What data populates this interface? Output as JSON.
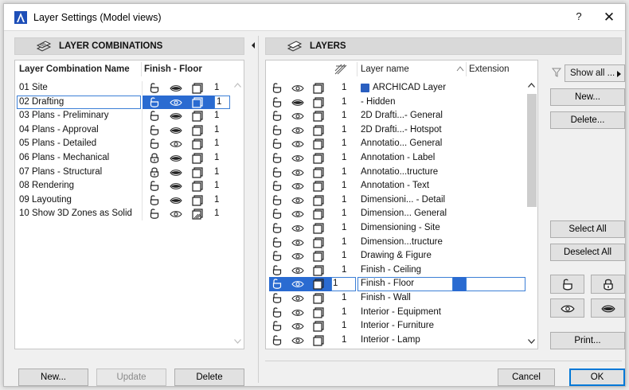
{
  "window": {
    "title": "Layer Settings (Model views)",
    "help_label": "?",
    "close_label": "✕"
  },
  "layer_combinations": {
    "header": "LAYER COMBINATIONS",
    "columns": {
      "name": "Layer Combination Name",
      "finish": "Finish - Floor"
    },
    "rows": [
      {
        "name": "01 Site",
        "lock": "unlocked",
        "visibility": "closed-eye",
        "wire": "solid",
        "pen": "1",
        "selected": false
      },
      {
        "name": "02 Drafting",
        "lock": "unlocked",
        "visibility": "open-eye",
        "wire": "solid",
        "pen": "1",
        "selected": true
      },
      {
        "name": "03 Plans - Preliminary",
        "lock": "unlocked",
        "visibility": "closed-eye",
        "wire": "solid",
        "pen": "1",
        "selected": false
      },
      {
        "name": "04 Plans - Approval",
        "lock": "unlocked",
        "visibility": "closed-eye",
        "wire": "solid",
        "pen": "1",
        "selected": false
      },
      {
        "name": "05 Plans - Detailed",
        "lock": "unlocked",
        "visibility": "open-eye",
        "wire": "solid",
        "pen": "1",
        "selected": false
      },
      {
        "name": "06 Plans - Mechanical",
        "lock": "locked",
        "visibility": "closed-eye",
        "wire": "solid",
        "pen": "1",
        "selected": false
      },
      {
        "name": "07 Plans - Structural",
        "lock": "locked",
        "visibility": "closed-eye",
        "wire": "solid",
        "pen": "1",
        "selected": false
      },
      {
        "name": "08 Rendering",
        "lock": "unlocked",
        "visibility": "closed-eye",
        "wire": "solid",
        "pen": "1",
        "selected": false
      },
      {
        "name": "09 Layouting",
        "lock": "unlocked",
        "visibility": "closed-eye",
        "wire": "solid",
        "pen": "1",
        "selected": false
      },
      {
        "name": "10 Show 3D Zones as Solid",
        "lock": "unlocked",
        "visibility": "open-eye",
        "wire": "hatched",
        "pen": "1",
        "selected": false
      }
    ],
    "buttons": {
      "new": "New...",
      "update": "Update",
      "delete": "Delete"
    }
  },
  "layers": {
    "header": "LAYERS",
    "columns": {
      "name": "Layer name",
      "extension": "Extension"
    },
    "rows": [
      {
        "name": "ARCHICAD Layer",
        "visibility": "open-eye",
        "pen": "1",
        "badge": true,
        "selected": false
      },
      {
        "name": "- Hidden",
        "visibility": "closed-eye",
        "pen": "1",
        "badge": false,
        "selected": false
      },
      {
        "name": "2D Drafti...- General",
        "visibility": "open-eye",
        "pen": "1",
        "badge": false,
        "selected": false
      },
      {
        "name": "2D Drafti...- Hotspot",
        "visibility": "open-eye",
        "pen": "1",
        "badge": false,
        "selected": false
      },
      {
        "name": "Annotatio... General",
        "visibility": "open-eye",
        "pen": "1",
        "badge": false,
        "selected": false
      },
      {
        "name": "Annotation - Label",
        "visibility": "open-eye",
        "pen": "1",
        "badge": false,
        "selected": false
      },
      {
        "name": "Annotatio...tructure",
        "visibility": "open-eye",
        "pen": "1",
        "badge": false,
        "selected": false
      },
      {
        "name": "Annotation - Text",
        "visibility": "open-eye",
        "pen": "1",
        "badge": false,
        "selected": false
      },
      {
        "name": "Dimensioni... - Detail",
        "visibility": "open-eye",
        "pen": "1",
        "badge": false,
        "selected": false
      },
      {
        "name": "Dimension... General",
        "visibility": "open-eye",
        "pen": "1",
        "badge": false,
        "selected": false
      },
      {
        "name": "Dimensioning - Site",
        "visibility": "open-eye",
        "pen": "1",
        "badge": false,
        "selected": false
      },
      {
        "name": "Dimension...tructure",
        "visibility": "open-eye",
        "pen": "1",
        "badge": false,
        "selected": false
      },
      {
        "name": "Drawing & Figure",
        "visibility": "open-eye",
        "pen": "1",
        "badge": false,
        "selected": false
      },
      {
        "name": "Finish - Ceiling",
        "visibility": "open-eye",
        "pen": "1",
        "badge": false,
        "selected": false
      },
      {
        "name": "Finish - Floor",
        "visibility": "open-eye",
        "pen": "1",
        "badge": false,
        "selected": true
      },
      {
        "name": "Finish - Wall",
        "visibility": "open-eye",
        "pen": "1",
        "badge": false,
        "selected": false
      },
      {
        "name": "Interior - Equipment",
        "visibility": "open-eye",
        "pen": "1",
        "badge": false,
        "selected": false
      },
      {
        "name": "Interior - Furniture",
        "visibility": "open-eye",
        "pen": "1",
        "badge": false,
        "selected": false
      },
      {
        "name": "Interior - Lamp",
        "visibility": "open-eye",
        "pen": "1",
        "badge": false,
        "selected": false
      }
    ],
    "filter_label": "Show all ...",
    "buttons": {
      "new": "New...",
      "delete": "Delete...",
      "select_all": "Select All",
      "deselect_all": "Deselect All",
      "print": "Print..."
    }
  },
  "footer": {
    "cancel": "Cancel",
    "ok": "OK"
  },
  "colors": {
    "selection": "#2a6bd1",
    "selection_border": "#3c7fd6",
    "primary_border": "#0078d7"
  }
}
